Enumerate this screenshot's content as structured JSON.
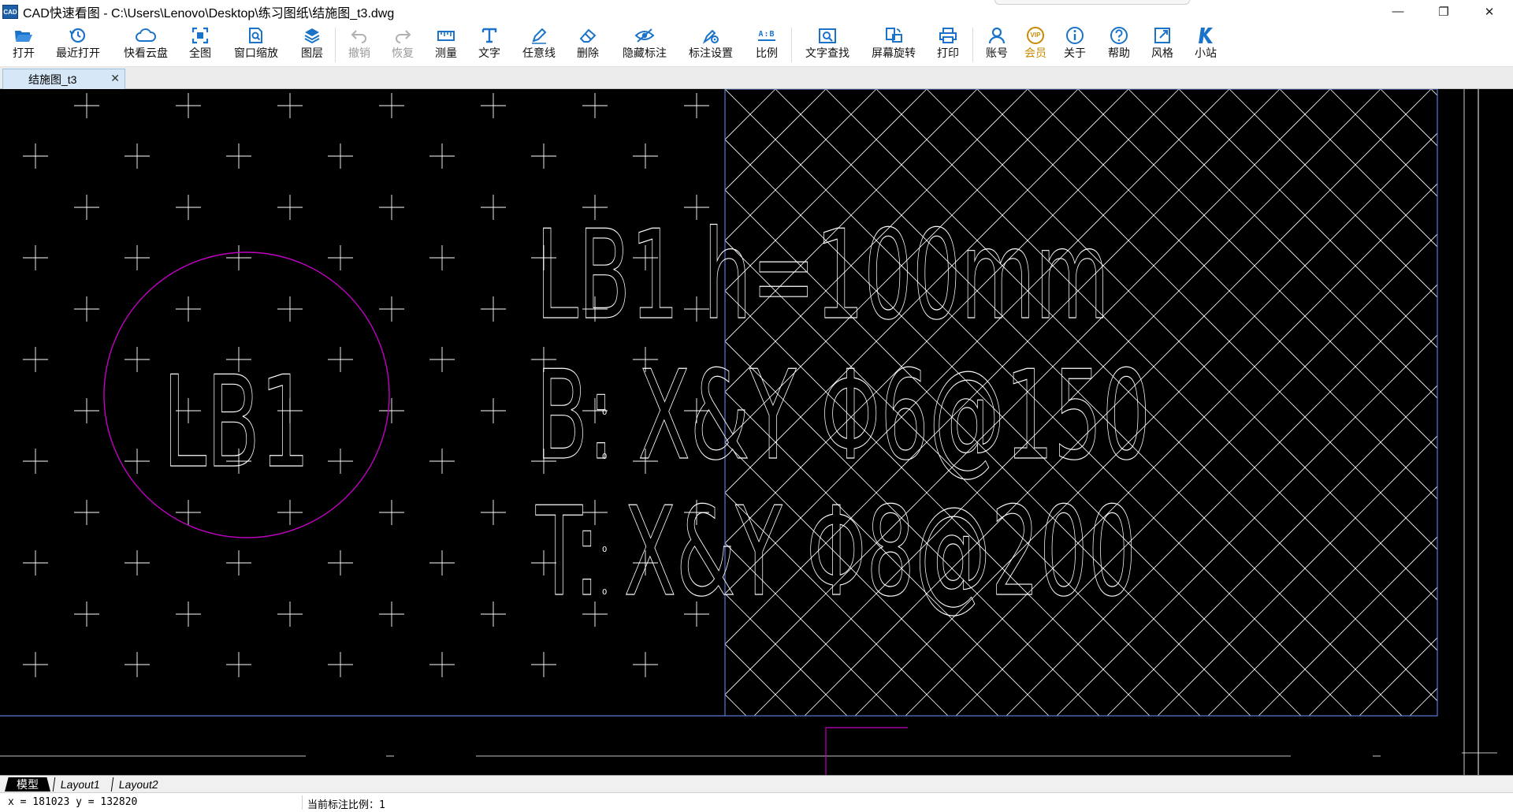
{
  "window": {
    "title": "CAD快速看图 - C:\\Users\\Lenovo\\Desktop\\练习图纸\\结施图_t3.dwg",
    "app_icon_text": "CAD",
    "minimize": "—",
    "restore": "❐",
    "close": "✕"
  },
  "toolbar": {
    "open": "打开",
    "recent": "最近打开",
    "cloud": "快看云盘",
    "fit_all": "全图",
    "window_zoom": "窗口缩放",
    "layers": "图层",
    "undo": "撤销",
    "redo": "恢复",
    "measure": "测量",
    "text": "文字",
    "freehand": "任意线",
    "delete": "删除",
    "hide_markup": "隐藏标注",
    "markup_settings": "标注设置",
    "ratio": "比例",
    "find_text": "文字查找",
    "rotate_screen": "屏幕旋转",
    "print": "打印",
    "account": "账号",
    "vip": "会员",
    "about": "关于",
    "help": "帮助",
    "style": "风格",
    "mini_site": "小站",
    "vip_badge": "VIP",
    "ratio_icon": "A:B"
  },
  "colors": {
    "accent": "#1a73c9",
    "vip": "#c98a00",
    "canvas_bg": "#000000",
    "drawing_white": "#ffffff",
    "magenta": "#c000c0",
    "frame_blue": "#5a78d8"
  },
  "tabs": {
    "document": "结施图_t3",
    "close": "✕"
  },
  "drawing": {
    "circle_label": "LB1",
    "line1": "LB1 h=100mm",
    "line2": "B: X&Y Φ6@150",
    "line3": "T: X&Y Φ8@200",
    "small_mark": "0"
  },
  "layouts": {
    "model": "模型",
    "layout1": "Layout1",
    "layout2": "Layout2"
  },
  "status": {
    "coords": "x = 181023  y = 132820",
    "scale": "当前标注比例：1"
  }
}
